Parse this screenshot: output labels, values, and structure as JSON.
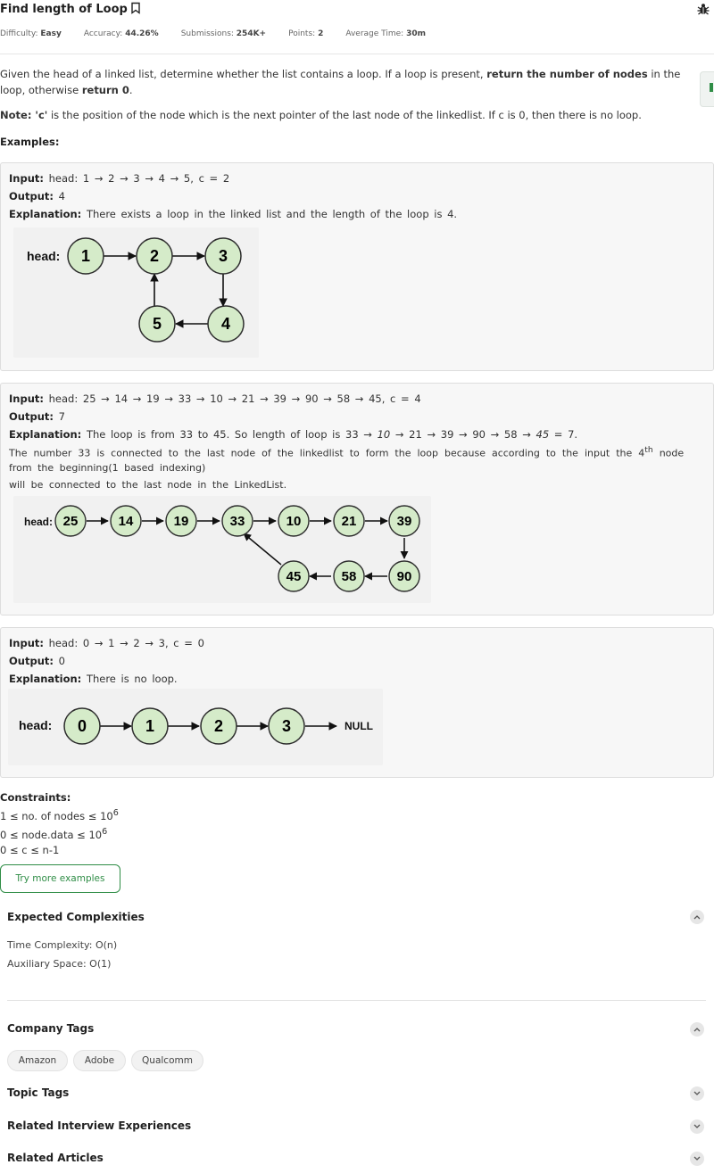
{
  "problem": {
    "title": "Find length of Loop",
    "meta": {
      "difficulty_label": "Difficulty:",
      "difficulty": "Easy",
      "accuracy_label": "Accuracy:",
      "accuracy": "44.26%",
      "submissions_label": "Submissions:",
      "submissions": "254K+",
      "points_label": "Points:",
      "points": "2",
      "avg_time_label": "Average Time:",
      "avg_time": "30m"
    },
    "description": {
      "part1": "Given the head of a linked list, determine whether the list contains a loop. If a loop is present, ",
      "bold1": "return the number of nodes",
      "part2": " in the loop, otherwise ",
      "bold2": "return 0",
      "part3": "."
    },
    "note": {
      "label": "Note: 'c'",
      "text": " is the position of the node which is the next pointer of the last node of the linkedlist. If c is 0, then there is no loop."
    },
    "examples_heading": "Examples:"
  },
  "examples": [
    {
      "input_label": "Input:",
      "input": "head: 1 → 2 → 3 → 4 → 5, c = 2",
      "output_label": "Output:",
      "output": "4",
      "explanation_label": "Explanation:",
      "explanation": "There exists a loop in the linked list and the length of the loop is 4.",
      "diagram": {
        "head_label": "head:",
        "nodes": [
          "1",
          "2",
          "3",
          "4",
          "5"
        ]
      }
    },
    {
      "input_label": "Input:",
      "input": "head: 25 → 14 → 19 → 33 → 10 → 21 → 39 → 90 → 58 → 45, c = 4",
      "output_label": "Output:",
      "output": "7",
      "explanation_label": "Explanation:",
      "explanation_a": "The loop is from 33 to 45. So length of loop is 33 → ",
      "explanation_i1": "10",
      "explanation_b": " → 21 → 39 → 90 → 58 → ",
      "explanation_i2": "45",
      "explanation_c": " = 7.",
      "extra_line1_a": "The number 33 is connected to the last node of the linkedlist to form the loop because according to the input the 4",
      "extra_line1_sup": "th",
      "extra_line1_b": " node",
      "extra_line2": "from the beginning(1 based indexing)",
      "extra_line3": "will be connected to the last node in the LinkedList.",
      "diagram": {
        "head_label": "head:",
        "nodes": [
          "25",
          "14",
          "19",
          "33",
          "10",
          "21",
          "39",
          "90",
          "58",
          "45"
        ]
      }
    },
    {
      "input_label": "Input:",
      "input": "head: 0 → 1 → 2 → 3, c = 0",
      "output_label": "Output:",
      "output": "0",
      "explanation_label": "Explanation:",
      "explanation": "There is no loop.",
      "diagram": {
        "head_label": "head:",
        "nodes": [
          "0",
          "1",
          "2",
          "3"
        ],
        "null_label": "NULL"
      }
    }
  ],
  "constraints": {
    "heading": "Constraints:",
    "c1": "1 ≤ no. of nodes ≤ 10",
    "c1_sup": "6",
    "c2": "0 ≤ node.data ≤ 10",
    "c2_sup": "6",
    "c3": "0 ≤ c ≤ n-1"
  },
  "try_more_button": "Try more examples",
  "sections": {
    "expected_complexities": "Expected Complexities",
    "time_complexity": "Time Complexity: O(n)",
    "auxiliary_space": "Auxiliary Space: O(1)",
    "company_tags": "Company Tags",
    "company_list": [
      "Amazon",
      "Adobe",
      "Qualcomm"
    ],
    "topic_tags": "Topic Tags",
    "related_interview": "Related Interview Experiences",
    "related_articles": "Related Articles"
  },
  "colors": {
    "accent": "#2f8d46",
    "node_fill": "#d5ebc9",
    "node_stroke": "#2d2d2d"
  }
}
